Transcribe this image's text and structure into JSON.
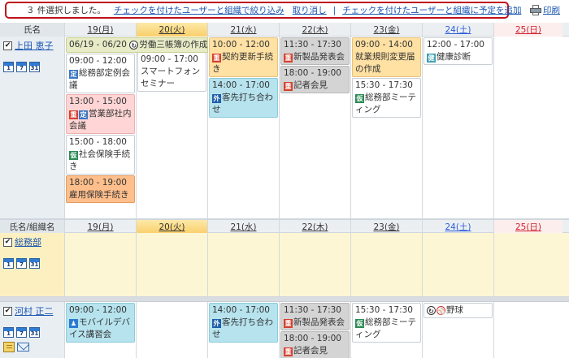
{
  "toolbar": {
    "selected_count": "３ 件選択しました。",
    "filter_link": "チェックを付けたユーザーと組織で絞り込み",
    "cancel_link": "取り消し",
    "separator": "|",
    "add_link": "チェックを付けたユーザーと組織に予定を追加",
    "print_label": "印刷"
  },
  "header1": {
    "name_col": "氏名",
    "days": [
      "19(月)",
      "20(火)",
      "21(水)",
      "22(木)",
      "23(金)",
      "24(土)",
      "25(日)"
    ]
  },
  "header2": {
    "name_col": "氏名/組織名",
    "days": [
      "19(月)",
      "20(火)",
      "21(水)",
      "22(木)",
      "23(金)",
      "24(土)",
      "25(日)"
    ]
  },
  "cal_icons": [
    "1",
    "7",
    "31"
  ],
  "users": [
    {
      "name": "上田 恵子",
      "checked": "✔",
      "banner": {
        "range": "06/19 - 06/20",
        "tag": "repeat-icon",
        "title": "労働三帳簿の作成"
      },
      "days": [
        [
          {
            "time": "09:00 - 12:00",
            "tag": "定",
            "title": "総務部定例会議"
          },
          {
            "time": "13:00 - 15:00",
            "tag": "重",
            "tag2": "定",
            "title": "営業部社内会議"
          },
          {
            "time": "15:00 - 18:00",
            "tag": "仮",
            "title": "社会保険手続き"
          },
          {
            "time": "18:00 - 19:00",
            "title": "雇用保険手続き"
          }
        ],
        [
          {
            "time": "09:00 - 17:00",
            "title": "スマートフォンセミナー"
          }
        ],
        [
          {
            "time": "10:00 - 12:00",
            "tag": "重",
            "title": "契約更新手続き"
          },
          {
            "time": "14:00 - 17:00",
            "tag": "外",
            "title": "客先打ち合わせ"
          }
        ],
        [
          {
            "time": "11:30 - 17:30",
            "tag": "重",
            "title": "新製品発表会"
          },
          {
            "time": "18:00 - 19:00",
            "tag": "重",
            "title": "記者会見"
          }
        ],
        [
          {
            "time": "09:00 - 14:00",
            "title": "就業規則変更届の作成"
          },
          {
            "time": "15:30 - 17:30",
            "tag": "仮",
            "title": "総務部ミーティング"
          }
        ],
        [
          {
            "time": "12:00 - 17:00",
            "tag": "健",
            "title": "健康診断"
          }
        ]
      ]
    },
    {
      "name": "総務部",
      "checked": "✔"
    },
    {
      "name": "河村 正二",
      "checked": "✔",
      "days": [
        [
          {
            "time": "09:00 - 12:00",
            "title": "モバイルデバイス講習会"
          }
        ],
        [],
        [
          {
            "time": "14:00 - 17:00",
            "tag": "外",
            "title": "客先打ち合わせ"
          }
        ],
        [
          {
            "time": "11:30 - 17:30",
            "tag": "重",
            "title": "新製品発表会"
          },
          {
            "time": "18:00 - 19:00",
            "tag": "重",
            "title": "記者会見"
          }
        ],
        [
          {
            "time": "15:30 - 17:30",
            "tag": "仮",
            "title": "総務部ミーティング"
          }
        ],
        [
          {
            "tag": "ball-icon",
            "title": "野球"
          }
        ]
      ]
    }
  ]
}
